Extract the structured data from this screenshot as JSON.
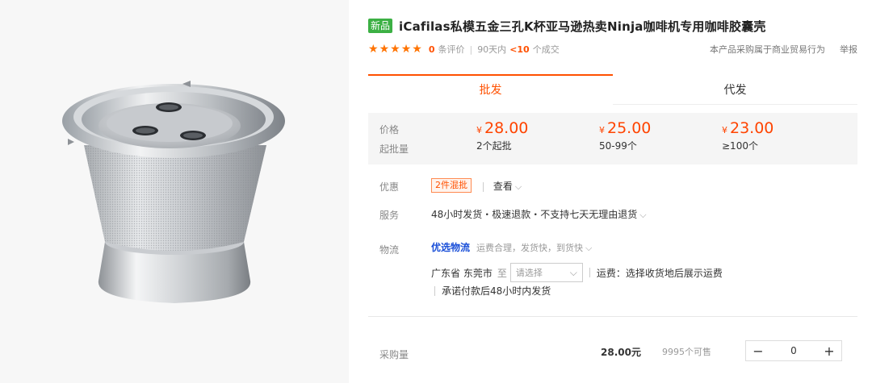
{
  "product": {
    "badge": "新品",
    "title": "iCafilas私模五金三孔K杯亚马逊热卖Ninja咖啡机专用咖啡胶囊壳"
  },
  "rating": {
    "stars": 5,
    "review_count": "0",
    "review_label": "条评价",
    "period_label": "90天内",
    "deals_value": "<10",
    "deals_label": "个成交",
    "commercial_note": "本产品采购属于商业贸易行为",
    "report_label": "举报"
  },
  "tabs": [
    {
      "label": "批发",
      "active": true
    },
    {
      "label": "代发",
      "active": false
    }
  ],
  "pricing": {
    "price_label": "价格",
    "moq_label": "起批量",
    "currency": "¥",
    "tiers": [
      {
        "price": "28.00",
        "qty": "2个起批"
      },
      {
        "price": "25.00",
        "qty": "50-99个"
      },
      {
        "price": "23.00",
        "qty": "≥100个"
      }
    ]
  },
  "promo": {
    "label": "优惠",
    "tag": "2件混批",
    "view_label": "查看"
  },
  "service": {
    "label": "服务",
    "text": "48小时发货・极速退款・不支持七天无理由退货"
  },
  "logistics": {
    "label": "物流",
    "brand": "优选物流",
    "desc": "运费合理，发货快，到货快",
    "origin": "广东省 东莞市",
    "to_label": "至",
    "select_placeholder": "请选择",
    "freight": "运费：选择收货地后展示运费",
    "ship_promise": "承诺付款后48小时内发货"
  },
  "purchase": {
    "label": "采购量",
    "price": "28.00元",
    "stock": "9995个可售",
    "quantity": "0",
    "minus": "−",
    "plus": "+"
  },
  "colors": {
    "accent": "#ff5000",
    "price": "#ff4400",
    "star": "#ff7300",
    "new_badge": "#3cb044",
    "logistics_brand": "#1a4fd8"
  }
}
